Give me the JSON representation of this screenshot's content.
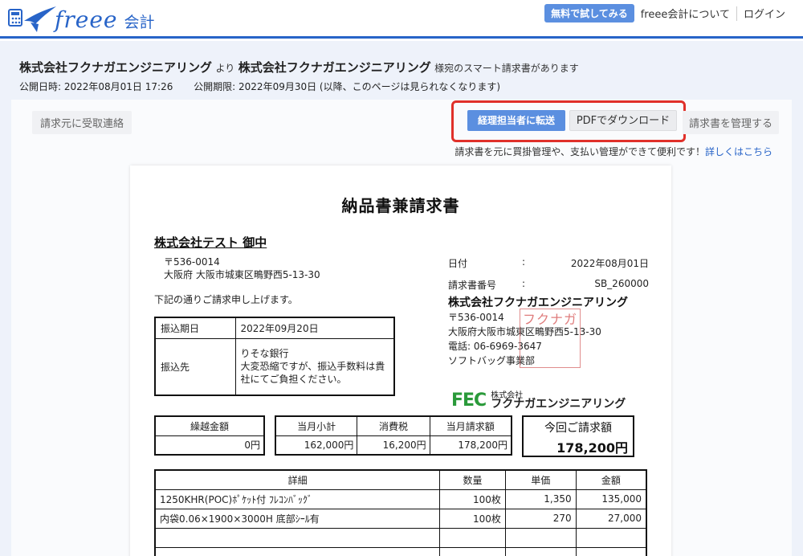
{
  "header": {
    "brand": "freee",
    "brand_sub": "会計",
    "trial_button": "無料で試してみる",
    "about_link": "freee会計について",
    "login_link": "ログイン"
  },
  "notice": {
    "from_company": "株式会社フクナガエンジニアリング",
    "from_word": "より",
    "to_company": "株式会社フクナガエンジニアリング",
    "message": "様宛のスマート請求書があります",
    "published": "公開日時: 2022年08月01日 17:26",
    "expires": "公開期限: 2022年09月30日 (以降、このページは見られなくなります)"
  },
  "actions": {
    "contact_sender": "請求元に受取連絡",
    "forward_accounting": "経理担当者に転送",
    "download_pdf": "PDFでダウンロード",
    "manage_invoice": "請求書を管理する",
    "info_text": "請求書を元に買掛管理や、支払い管理ができて便利です！",
    "info_link": "詳しくはこちら"
  },
  "invoice": {
    "title": "納品書兼請求書",
    "client": "株式会社テスト 御中",
    "client_postal": "〒536-0014",
    "client_address": "大阪府 大阪市城東区鴫野西5-13-30",
    "note": "下記の通りご請求申し上げます。",
    "date_label": "日付",
    "date_value": "2022年08月01日",
    "number_label": "請求書番号",
    "number_value": "SB_260000",
    "colon": ":",
    "issuer_name": "株式会社フクナガエンジニアリング",
    "issuer_postal": "〒536-0014",
    "issuer_address": "大阪府大阪市城東区鴫野西5-13-30",
    "issuer_phone": "電話: 06-6969-3647",
    "issuer_division": "ソフトバッグ事業部",
    "seal_text": "フクナガ",
    "logo_mark": "FEC",
    "logo_kk": "株式会社",
    "logo_name": "フクナガエンジニアリング",
    "payment": {
      "due_label": "振込期日",
      "due_value": "2022年09月20日",
      "account_label": "振込先",
      "bank": "りそな銀行",
      "fee_note": "大変恐縮ですが、振込手数料は貴社にてご負担ください。"
    },
    "carryover": {
      "label": "繰越金額",
      "value": "0円"
    },
    "summary": {
      "headers": [
        "当月小計",
        "消費税",
        "当月請求額"
      ],
      "values": [
        "162,000円",
        "16,200円",
        "178,200円"
      ]
    },
    "total": {
      "label": "今回ご請求額",
      "value": "178,200円"
    },
    "detail": {
      "headers": [
        "詳細",
        "数量",
        "単価",
        "金額"
      ],
      "rows": [
        [
          "1250KHR(POC)ﾎﾟｹｯﾄ付 ﾌﾚｺﾝﾊﾞｯｸﾞ",
          "100枚",
          "1,350",
          "135,000"
        ],
        [
          "内袋0.06×1900×3000H 底部ｼｰﾙ有",
          "100枚",
          "270",
          "27,000"
        ],
        [
          "",
          "",
          "",
          ""
        ],
        [
          "",
          "",
          "",
          ""
        ]
      ]
    }
  },
  "colors": {
    "brand_blue": "#2864c8",
    "button_blue": "#5b8fe0",
    "highlight_red": "#e0302a",
    "logo_green": "#2a9a3a"
  }
}
